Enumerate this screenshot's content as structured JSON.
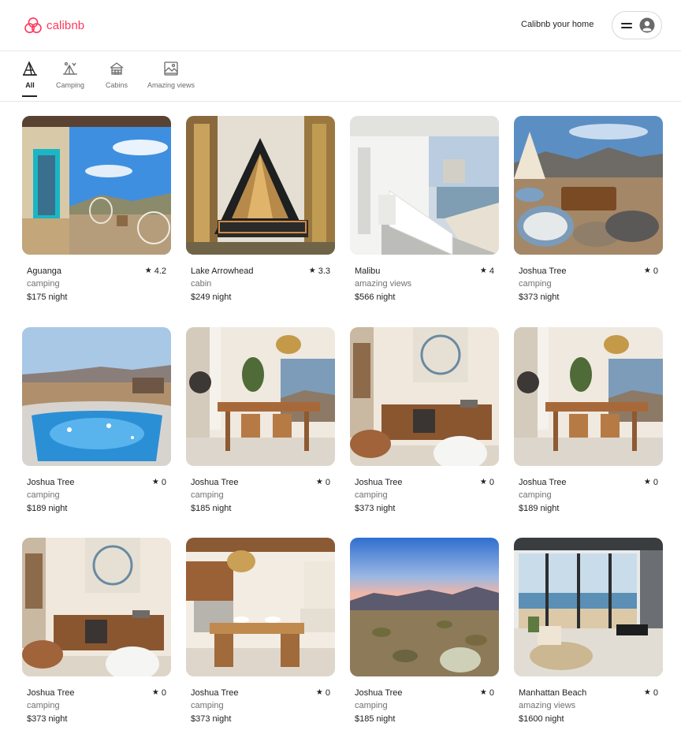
{
  "brand": {
    "name": "calibnb",
    "color": "#ff385c"
  },
  "header": {
    "host_link": "Calibnb your home",
    "menu_icon": "hamburger-icon",
    "avatar_icon": "user-avatar-icon"
  },
  "categories": [
    {
      "label": "All",
      "icon": "a-frame-icon",
      "active": true
    },
    {
      "label": "Camping",
      "icon": "camping-tent-icon",
      "active": false
    },
    {
      "label": "Cabins",
      "icon": "cabin-icon",
      "active": false
    },
    {
      "label": "Amazing views",
      "icon": "landscape-view-icon",
      "active": false
    }
  ],
  "listings": [
    {
      "location": "Aguanga",
      "rating": "4.2",
      "category": "camping",
      "price": "$175 night"
    },
    {
      "location": "Lake Arrowhead",
      "rating": "3.3",
      "category": "cabin",
      "price": "$249 night"
    },
    {
      "location": "Malibu",
      "rating": "4",
      "category": "amazing views",
      "price": "$566 night"
    },
    {
      "location": "Joshua Tree",
      "rating": "0",
      "category": "camping",
      "price": "$373 night"
    },
    {
      "location": "Joshua Tree",
      "rating": "0",
      "category": "camping",
      "price": "$189 night"
    },
    {
      "location": "Joshua Tree",
      "rating": "0",
      "category": "camping",
      "price": "$185 night"
    },
    {
      "location": "Joshua Tree",
      "rating": "0",
      "category": "camping",
      "price": "$373 night"
    },
    {
      "location": "Joshua Tree",
      "rating": "0",
      "category": "camping",
      "price": "$189 night"
    },
    {
      "location": "Joshua Tree",
      "rating": "0",
      "category": "camping",
      "price": "$373 night"
    },
    {
      "location": "Joshua Tree",
      "rating": "0",
      "category": "camping",
      "price": "$373 night"
    },
    {
      "location": "Joshua Tree",
      "rating": "0",
      "category": "camping",
      "price": "$185 night"
    },
    {
      "location": "Manhattan Beach",
      "rating": "0",
      "category": "amazing views",
      "price": "$1600 night"
    }
  ]
}
